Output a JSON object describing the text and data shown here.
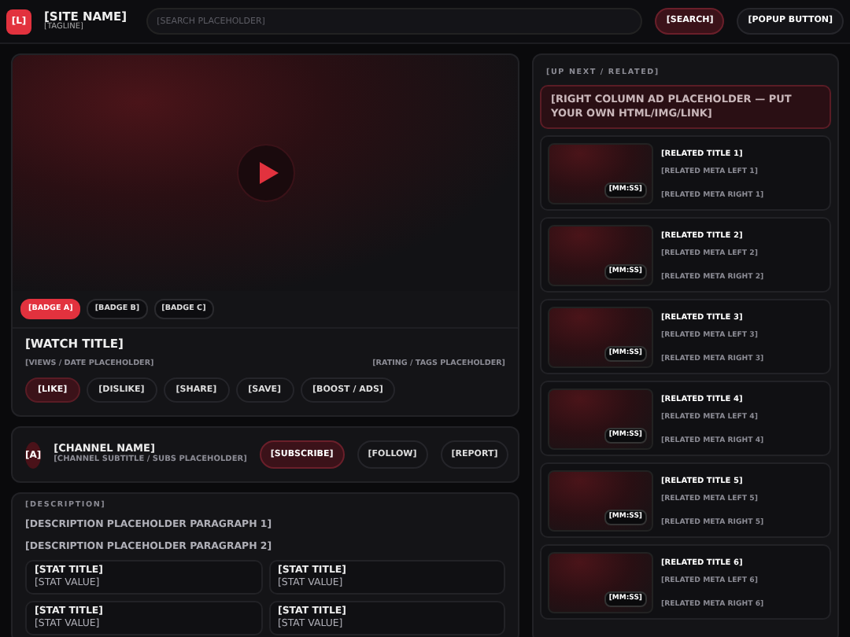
{
  "header": {
    "logo": "[L]",
    "site_name": "[SITE NAME]",
    "tagline": "[TAGLINE]",
    "search": {
      "placeholder": "[SEARCH PLACEHOLDER]"
    },
    "buttons": [
      {
        "label": "[SEARCH]",
        "kind": "primary"
      },
      {
        "label": "[POPUP BUTTON]",
        "kind": "plain"
      }
    ]
  },
  "video": {
    "badges": [
      {
        "label": "[BADGE A]",
        "selected": true
      },
      {
        "label": "[BADGE B]",
        "selected": false
      },
      {
        "label": "[BADGE C]",
        "selected": false
      }
    ],
    "title": "[WATCH TITLE]",
    "meta_left": "[VIEWS / DATE PLACEHOLDER]",
    "meta_right": "[RATING / TAGS PLACEHOLDER]",
    "actions": [
      {
        "label": "[LIKE]",
        "selected": true
      },
      {
        "label": "[DISLIKE]",
        "selected": false
      },
      {
        "label": "[SHARE]",
        "selected": false
      },
      {
        "label": "[SAVE]",
        "selected": false
      },
      {
        "label": "[BOOST / ADS]",
        "selected": false
      }
    ]
  },
  "channel": {
    "avatar": "[A]",
    "name": "[CHANNEL NAME]",
    "subtitle": "[CHANNEL SUBTITLE / SUBS PLACEHOLDER]",
    "buttons": [
      {
        "label": "[SUBSCRIBE]",
        "kind": "primary"
      },
      {
        "label": "[FOLLOW]",
        "kind": "plain"
      },
      {
        "label": "[REPORT]",
        "kind": "plain"
      }
    ]
  },
  "description": {
    "heading": "[DESCRIPTION]",
    "paragraphs": [
      "[DESCRIPTION PLACEHOLDER PARAGRAPH 1]",
      "[DESCRIPTION PLACEHOLDER PARAGRAPH 2]"
    ],
    "stats": [
      {
        "title": "[STAT TITLE]",
        "value": "[STAT VALUE]"
      },
      {
        "title": "[STAT TITLE]",
        "value": "[STAT VALUE]"
      },
      {
        "title": "[STAT TITLE]",
        "value": "[STAT VALUE]"
      },
      {
        "title": "[STAT TITLE]",
        "value": "[STAT VALUE]"
      }
    ]
  },
  "sidebar": {
    "heading": "[UP NEXT / RELATED]",
    "ad": "[RIGHT COLUMN AD PLACEHOLDER — PUT YOUR OWN HTML/IMG/LINK]",
    "items": [
      {
        "title": "[RELATED TITLE 1]",
        "meta_left": "[RELATED META LEFT 1]",
        "meta_right": "[RELATED META RIGHT 1]",
        "duration": "[MM:SS]"
      },
      {
        "title": "[RELATED TITLE 2]",
        "meta_left": "[RELATED META LEFT 2]",
        "meta_right": "[RELATED META RIGHT 2]",
        "duration": "[MM:SS]"
      },
      {
        "title": "[RELATED TITLE 3]",
        "meta_left": "[RELATED META LEFT 3]",
        "meta_right": "[RELATED META RIGHT 3]",
        "duration": "[MM:SS]"
      },
      {
        "title": "[RELATED TITLE 4]",
        "meta_left": "[RELATED META LEFT 4]",
        "meta_right": "[RELATED META RIGHT 4]",
        "duration": "[MM:SS]"
      },
      {
        "title": "[RELATED TITLE 5]",
        "meta_left": "[RELATED META LEFT 5]",
        "meta_right": "[RELATED META RIGHT 5]",
        "duration": "[MM:SS]"
      },
      {
        "title": "[RELATED TITLE 6]",
        "meta_left": "[RELATED META LEFT 6]",
        "meta_right": "[RELATED META RIGHT 6]",
        "duration": "[MM:SS]"
      }
    ]
  }
}
